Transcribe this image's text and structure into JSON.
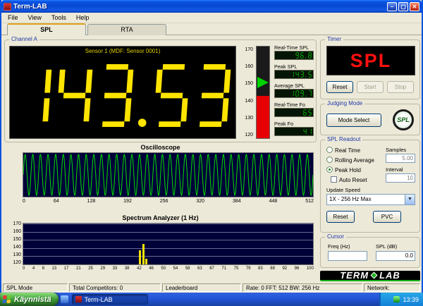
{
  "window": {
    "title": "Term-LAB",
    "menu": [
      "File",
      "View",
      "Tools",
      "Help"
    ],
    "tab_spl": "SPL",
    "tab_rta": "RTA"
  },
  "channel": {
    "label": "Channel A",
    "sensor": "Sensor 1 (MDF: Sensor 0001)",
    "display_value": "143.53",
    "meter_ticks": [
      "170",
      "160",
      "150",
      "140",
      "130",
      "120"
    ],
    "readouts": [
      {
        "label": "Real-Time SPL",
        "value": "96.8"
      },
      {
        "label": "Peak SPL",
        "value": "143.5"
      },
      {
        "label": "Average SPL",
        "value": "109.7"
      },
      {
        "label": "Real-Time Fo",
        "value": "65"
      },
      {
        "label": "Peak Fo",
        "value": "41"
      }
    ]
  },
  "timer": {
    "label": "Timer",
    "display": "SPL",
    "reset": "Reset",
    "start": "Start",
    "stop": "Stop"
  },
  "judging": {
    "label": "Judging Mode",
    "mode_select": "Mode Select",
    "badge": "SPL"
  },
  "spl_readout": {
    "label": "SPL Readout",
    "radio_real_time": "Real Time",
    "radio_rolling": "Rolling Average",
    "radio_peak": "Peak Hold",
    "auto_reset": "Auto Reset",
    "samples_label": "Samples",
    "samples_value": "5.00",
    "interval_label": "Interval",
    "interval_value": "10",
    "update_speed_label": "Update Speed",
    "update_speed_value": "1X - 256 Hz Max",
    "reset": "Reset",
    "pvc": "PVC"
  },
  "cursor": {
    "label": "Cursor",
    "freq_label": "Freq (Hz)",
    "spl_label": "SPL (dB)",
    "freq_value": "",
    "spl_value": "0.0"
  },
  "logo": {
    "left": "TERM",
    "right": "LAB"
  },
  "status": [
    "SPL Mode",
    "Total Competitors: 0",
    "Leaderboard",
    "Rate: 0 FFT: 512 BW: 256 Hz",
    "Network:"
  ],
  "taskbar": {
    "start": "Käynnistä",
    "task": "Term-LAB",
    "clock": "13:39"
  },
  "chart_data": [
    {
      "type": "line",
      "title": "Oscilloscope",
      "x_ticks": [
        0,
        64,
        128,
        192,
        256,
        320,
        384,
        448,
        512
      ],
      "xlim": [
        0,
        512
      ],
      "cycles": 38,
      "amplitude": 1,
      "color": "#00e000",
      "bg": "#000038"
    },
    {
      "type": "bar",
      "title": "Spectrum Analyzer (1 Hz)",
      "ylim": [
        120,
        170
      ],
      "y_ticks": [
        170,
        160,
        150,
        140,
        130,
        120
      ],
      "x_ticks": [
        0,
        4,
        8,
        13,
        17,
        21,
        25,
        29,
        33,
        38,
        42,
        46,
        50,
        54,
        58,
        63,
        67,
        71,
        75,
        79,
        83,
        88,
        92,
        96,
        100
      ],
      "xlim": [
        0,
        100
      ],
      "bars": [
        {
          "x": 40,
          "v": 137
        },
        {
          "x": 41,
          "v": 145
        },
        {
          "x": 42,
          "v": 127
        }
      ],
      "color": "#f6e200",
      "bg": "#000038"
    }
  ]
}
